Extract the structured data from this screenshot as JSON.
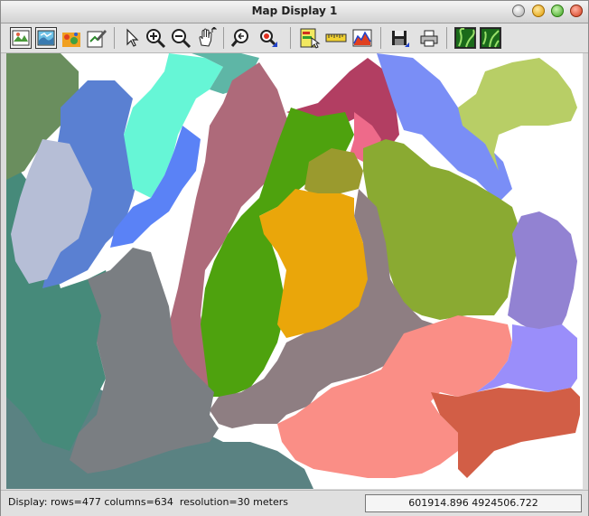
{
  "window": {
    "title": "Map Display 1"
  },
  "toolbar": {
    "buttons": [
      {
        "name": "display-active-layers-icon"
      },
      {
        "name": "redraw-all-icon"
      },
      {
        "name": "erase-display-icon"
      },
      {
        "name": "add-overlay-icon"
      },
      {
        "name": "pointer-icon"
      },
      {
        "name": "zoom-in-icon"
      },
      {
        "name": "zoom-out-icon"
      },
      {
        "name": "pan-icon"
      },
      {
        "name": "zoom-back-icon"
      },
      {
        "name": "zoom-menu-icon"
      },
      {
        "name": "query-icon"
      },
      {
        "name": "measure-icon"
      },
      {
        "name": "profile-icon"
      },
      {
        "name": "save-display-icon"
      },
      {
        "name": "print-icon"
      },
      {
        "name": "2d-view-icon"
      },
      {
        "name": "3d-view-icon"
      }
    ]
  },
  "map": {
    "layer_colors": {
      "dark_green": "#6a8e5e",
      "medium_blue": "#5a80d2",
      "aquamarine": "#66f6d6",
      "teal": "#5eb6a6",
      "mauve": "#ae6a7a",
      "crimson": "#b23e62",
      "periwinkle": "#7a8ef6",
      "olive_light": "#b8ce66",
      "light_slate": "#b6bed6",
      "blue": "#5a82f6",
      "green": "#4ea20e",
      "pink": "#ee6a8a",
      "olive": "#8aaa32",
      "ochre": "#9a9a2e",
      "gold": "#eaa60a",
      "grayish_mauve": "#8e7e82",
      "dark_teal": "#468a7a",
      "gray": "#7a7e82",
      "slate_teal": "#5a8282",
      "lavender": "#9282d2",
      "violet": "#9a8efa",
      "salmon": "#fa8e86",
      "rust": "#d25e46"
    }
  },
  "status": {
    "text": "Display: rows=477 columns=634  resolution=30 meters",
    "coordinates": "601914.896 4924506.722"
  }
}
